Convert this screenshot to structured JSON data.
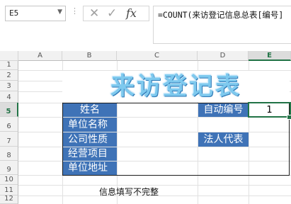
{
  "formula_bar": {
    "name_box": "E5",
    "dropdown_icon": "chevron-down-icon",
    "cancel_icon": "close-icon",
    "enter_icon": "check-icon",
    "function_icon": "fx-icon",
    "fx_label": "fx",
    "formula": "=COUNT(来访登记信息总表[编号]"
  },
  "columns": [
    "A",
    "B",
    "C",
    "D",
    "E"
  ],
  "rows": [
    "1",
    "2",
    "3",
    "4",
    "5",
    "6",
    "7",
    "8",
    "9",
    "10",
    "11",
    "12"
  ],
  "sheet": {
    "title": "来访登记表",
    "labels": {
      "name": "姓名",
      "company": "单位名称",
      "company_type": "公司性质",
      "business": "经营项目",
      "address": "单位地址",
      "auto_number": "自动编号",
      "legal_rep": "法人代表"
    },
    "auto_number_value": "1",
    "note": "信息填写不完整"
  },
  "colors": {
    "label_fill": "#3f73b7",
    "title_color": "#7ec9ee",
    "selection": "#217346"
  }
}
